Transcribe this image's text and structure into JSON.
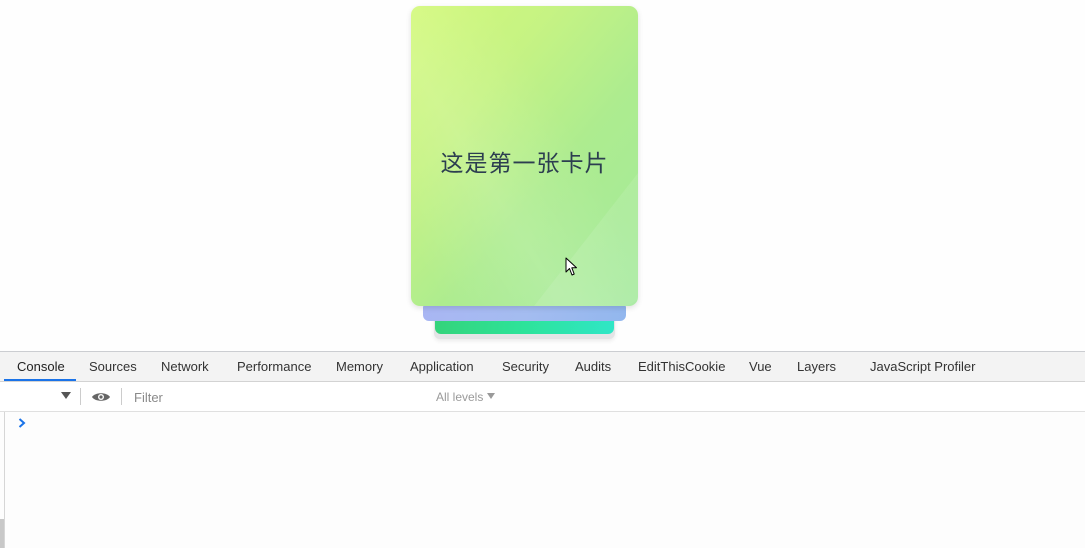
{
  "card": {
    "front_text": "这是第一张卡片"
  },
  "devtools": {
    "tabs": [
      {
        "label": "Console",
        "active": true
      },
      {
        "label": "Sources"
      },
      {
        "label": "Network"
      },
      {
        "label": "Performance"
      },
      {
        "label": "Memory"
      },
      {
        "label": "Application"
      },
      {
        "label": "Security"
      },
      {
        "label": "Audits"
      },
      {
        "label": "EditThisCookie"
      },
      {
        "label": "Vue"
      },
      {
        "label": "Layers"
      },
      {
        "label": "JavaScript Profiler"
      }
    ],
    "toolbar": {
      "filter_placeholder": "Filter",
      "levels_label": "All levels"
    }
  },
  "colors": {
    "accent": "#1a73e8",
    "card_text": "#2c3e50",
    "prompt": "#1a73e8"
  },
  "icons": {
    "context_dropdown": "chevron-down-icon",
    "live_expression": "eye-icon",
    "console_prompt": "chevron-right-icon",
    "mouse_cursor": "cursor-arrow-icon"
  }
}
